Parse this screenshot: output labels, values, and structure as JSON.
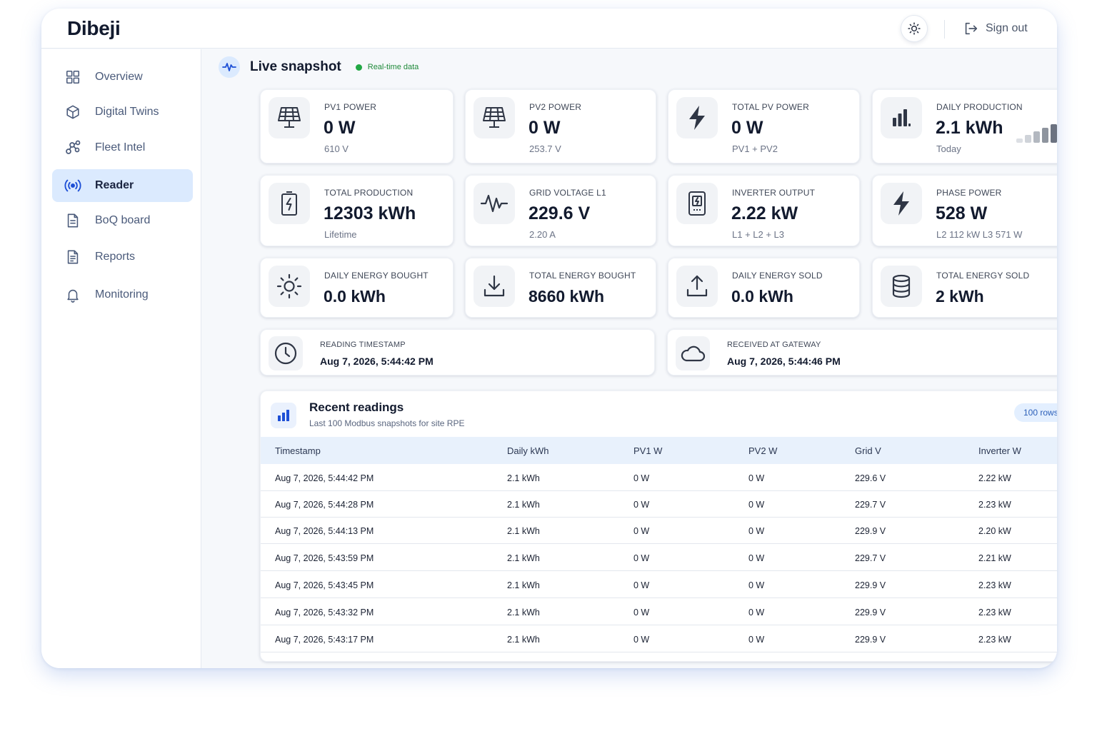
{
  "app": {
    "brand": "Dibeji",
    "sign_out_label": "Sign out"
  },
  "sidebar": {
    "items": [
      {
        "label": "Overview",
        "icon": "grid-icon",
        "active": false
      },
      {
        "label": "Digital Twins",
        "icon": "cube-icon",
        "active": false
      },
      {
        "label": "Fleet Intel",
        "icon": "network-icon",
        "active": false
      },
      {
        "label": "Reader",
        "icon": "broadcast-icon",
        "active": true
      },
      {
        "label": "BoQ board",
        "icon": "document-icon",
        "active": false
      },
      {
        "label": "Reports",
        "icon": "report-icon",
        "active": false
      },
      {
        "label": "Monitoring",
        "icon": "bell-icon",
        "active": false
      }
    ]
  },
  "snapshot": {
    "title": "Live snapshot",
    "live_label": "Real-time data",
    "cards": [
      {
        "label": "PV1 POWER",
        "value": "0 W",
        "sub": "610 V",
        "icon": "solar-panel-icon"
      },
      {
        "label": "PV2 POWER",
        "value": "0 W",
        "sub": "253.7 V",
        "icon": "solar-panel-icon"
      },
      {
        "label": "TOTAL PV POWER",
        "value": "0 W",
        "sub": "PV1 + PV2",
        "icon": "lightning-icon"
      },
      {
        "label": "DAILY PRODUCTION",
        "value": "2.1 kWh",
        "sub": "Today",
        "icon": "bar-chart-icon"
      },
      {
        "label": "TOTAL PRODUCTION",
        "value": "12303 kWh",
        "sub": "Lifetime",
        "icon": "battery-charge-icon"
      },
      {
        "label": "GRID VOLTAGE L1",
        "value": "229.6 V",
        "sub": "2.20 A",
        "icon": "waveform-icon"
      },
      {
        "label": "INVERTER OUTPUT",
        "value": "2.22 kW",
        "sub": "L1 + L2 + L3",
        "icon": "inverter-icon"
      },
      {
        "label": "PHASE POWER",
        "value": "528 W",
        "sub": "L2 112 kW  L3 571 W",
        "icon": "lightning-icon"
      },
      {
        "label": "DAILY ENERGY BOUGHT",
        "value": "0.0 kWh",
        "sub": "",
        "icon": "sun-icon"
      },
      {
        "label": "TOTAL ENERGY BOUGHT",
        "value": "8660 kWh",
        "sub": "",
        "icon": "download-icon"
      },
      {
        "label": "DAILY ENERGY SOLD",
        "value": "0.0 kWh",
        "sub": "",
        "icon": "upload-icon"
      },
      {
        "label": "TOTAL ENERGY SOLD",
        "value": "2 kWh",
        "sub": "",
        "icon": "database-icon"
      }
    ],
    "timestamps": [
      {
        "label": "READING TIMESTAMP",
        "value": "Aug 7, 2026, 5:44:42 PM",
        "icon": "clock-icon"
      },
      {
        "label": "RECEIVED AT GATEWAY",
        "value": "Aug 7, 2026, 5:44:46 PM",
        "icon": "cloud-icon"
      }
    ]
  },
  "readings": {
    "title": "Recent readings",
    "subtitle": "Last 100 Modbus snapshots for site RPE",
    "rows_badge": "100 rows",
    "columns": [
      "Timestamp",
      "Daily kWh",
      "PV1 W",
      "PV2 W",
      "Grid V",
      "Inverter W"
    ],
    "rows": [
      [
        "Aug 7, 2026, 5:44:42 PM",
        "2.1 kWh",
        "0 W",
        "0 W",
        "229.6 V",
        "2.22 kW"
      ],
      [
        "Aug 7, 2026, 5:44:28 PM",
        "2.1 kWh",
        "0 W",
        "0 W",
        "229.7 V",
        "2.23 kW"
      ],
      [
        "Aug 7, 2026, 5:44:13 PM",
        "2.1 kWh",
        "0 W",
        "0 W",
        "229.9 V",
        "2.20 kW"
      ],
      [
        "Aug 7, 2026, 5:43:59 PM",
        "2.1 kWh",
        "0 W",
        "0 W",
        "229.7 V",
        "2.21 kW"
      ],
      [
        "Aug 7, 2026, 5:43:45 PM",
        "2.1 kWh",
        "0 W",
        "0 W",
        "229.9 V",
        "2.23 kW"
      ],
      [
        "Aug 7, 2026, 5:43:32 PM",
        "2.1 kWh",
        "0 W",
        "0 W",
        "229.9 V",
        "2.23 kW"
      ],
      [
        "Aug 7, 2026, 5:43:17 PM",
        "2.1 kWh",
        "0 W",
        "0 W",
        "229.9 V",
        "2.23 kW"
      ]
    ]
  },
  "colors": {
    "accent": "#2563eb",
    "active_nav_bg": "#dbeafe",
    "live_dot": "#22a845",
    "bars_light": "#d4d7dc",
    "bars_dark": "#6b7280"
  }
}
